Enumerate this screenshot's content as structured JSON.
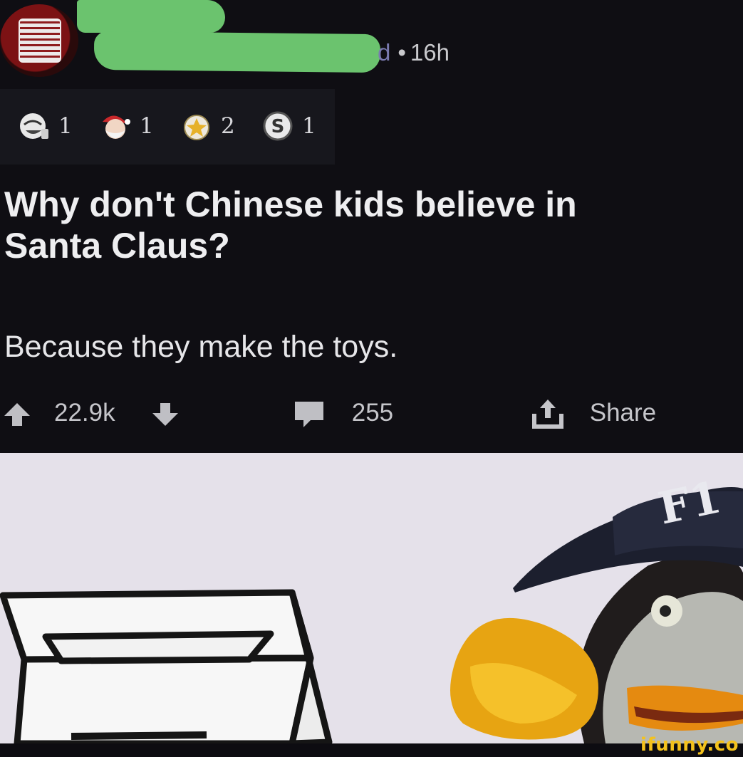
{
  "post": {
    "meta": {
      "time": "16h",
      "separator": "•",
      "username_fragment": "d"
    },
    "awards": [
      {
        "icon": "laughing-face-award-icon",
        "count": "1"
      },
      {
        "icon": "santa-award-icon",
        "count": "1"
      },
      {
        "icon": "gold-star-award-icon",
        "count": "2"
      },
      {
        "icon": "silver-award-icon",
        "count": "1"
      }
    ],
    "title_lines": [
      "Why don't Chinese kids believe in",
      "Santa Claus?"
    ],
    "body": "Because they make the toys.",
    "actions": {
      "upvote_icon": "upvote-arrow-icon",
      "score": "22.9k",
      "downvote_icon": "downvote-arrow-icon",
      "comment_icon": "comment-bubble-icon",
      "comments": "255",
      "share_icon": "share-icon",
      "share_label": "Share"
    }
  },
  "meme_image": {
    "subject": "cartoon-duck-with-cap-and-box"
  },
  "watermark": "ifunny.co",
  "colors": {
    "background": "#0f0e13",
    "redaction": "#6bc36e",
    "watermark": "#f4c21c"
  }
}
